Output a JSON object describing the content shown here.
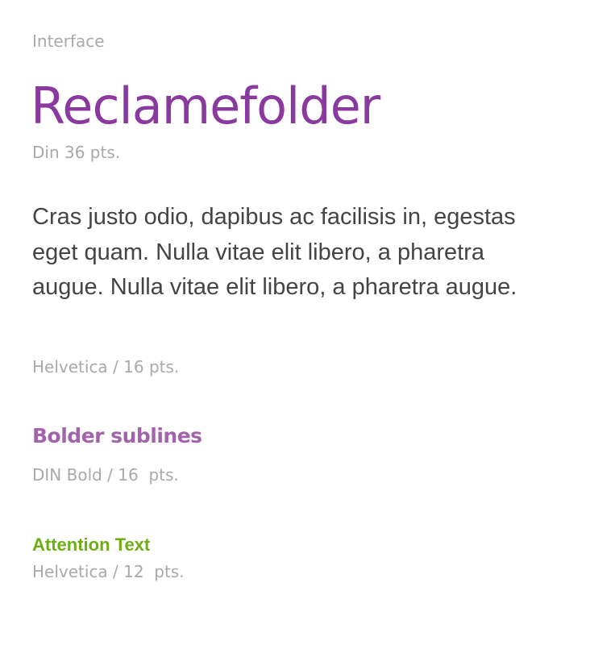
{
  "section_label": "Interface",
  "styles": [
    {
      "sample": "Reclamefolder",
      "spec": "Din 36 pts."
    },
    {
      "sample": "Cras justo odio, dapibus ac facilisis in, egestas eget quam. Nulla vitae elit libero, a pharetra augue. Nulla vitae elit libero, a pharetra augue.",
      "spec": "Helvetica / 16 pts."
    },
    {
      "sample": "Bolder sublines",
      "spec": "DIN Bold / 16  pts."
    },
    {
      "sample": "Attention Text",
      "spec": "Helvetica / 12  pts."
    }
  ],
  "colors": {
    "title": "#8a3a9e",
    "subline": "#a363ac",
    "attention": "#6fae12",
    "body": "#444444",
    "caption": "#a9a9a9"
  }
}
